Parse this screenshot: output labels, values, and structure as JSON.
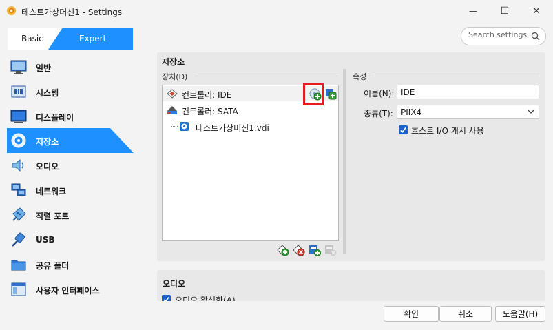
{
  "window": {
    "title": "테스트가상머신1 - Settings",
    "minimize_icon": "—",
    "maximize_icon": "☐",
    "close_icon": "✕"
  },
  "mode_tabs": {
    "basic": "Basic",
    "expert": "Expert"
  },
  "search": {
    "placeholder": "Search settings"
  },
  "sidebar": {
    "items": [
      {
        "label": "일반",
        "icon": "general-monitor-icon"
      },
      {
        "label": "시스템",
        "icon": "system-chip-icon"
      },
      {
        "label": "디스플레이",
        "icon": "display-monitor-icon"
      },
      {
        "label": "저장소",
        "icon": "storage-disk-icon",
        "active": true
      },
      {
        "label": "오디오",
        "icon": "audio-speaker-icon"
      },
      {
        "label": "네트워크",
        "icon": "network-icon"
      },
      {
        "label": "직렬 포트",
        "icon": "serial-port-icon"
      },
      {
        "label": "USB",
        "icon": "usb-icon"
      },
      {
        "label": "공유 폴더",
        "icon": "shared-folder-icon"
      },
      {
        "label": "사용자 인터페이스",
        "icon": "user-interface-icon"
      }
    ]
  },
  "storage": {
    "section_title": "저장소",
    "devices_label": "장치(D)",
    "tree": [
      {
        "label": "컨트롤러: IDE",
        "icon": "ide-controller-icon"
      },
      {
        "label": "컨트롤러: SATA",
        "icon": "sata-controller-icon"
      },
      {
        "label": "테스트가상머신1.vdi",
        "icon": "vdi-disk-icon"
      }
    ],
    "attributes": {
      "title": "속성",
      "name_label": "이름(N):",
      "name_value": "IDE",
      "type_label": "종류(T):",
      "type_value": "PIIX4",
      "host_io_cache": "호스트 I/O 캐시 사용"
    }
  },
  "audio": {
    "section_title": "오디오",
    "enable_label": "오디오 활성화(A)"
  },
  "buttons": {
    "ok": "확인",
    "cancel": "취소",
    "help": "도움말(H)"
  },
  "colors": {
    "accent": "#1e90ff",
    "highlight_box": "#e81c1c",
    "check": "#1a62c7"
  }
}
